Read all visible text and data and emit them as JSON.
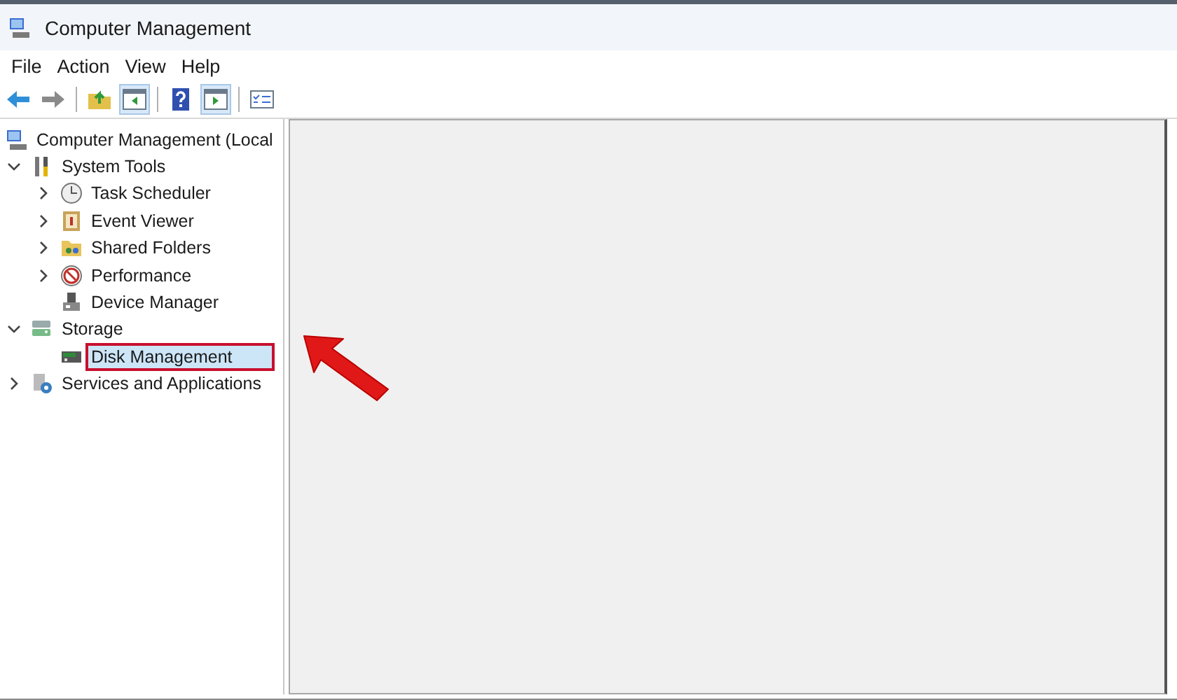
{
  "window": {
    "title": "Computer Management"
  },
  "menu": [
    "File",
    "Action",
    "View",
    "Help"
  ],
  "toolbar": [
    {
      "kind": "back",
      "pressed": false
    },
    {
      "kind": "forward",
      "pressed": false
    },
    {
      "kind": "sep"
    },
    {
      "kind": "up",
      "pressed": false
    },
    {
      "kind": "tree",
      "pressed": true
    },
    {
      "kind": "sep"
    },
    {
      "kind": "help",
      "pressed": false
    },
    {
      "kind": "pane",
      "pressed": true
    },
    {
      "kind": "sep"
    },
    {
      "kind": "props",
      "pressed": false
    }
  ],
  "tree": [
    {
      "label": "Computer Management (Local",
      "kind": "computer",
      "selected": false,
      "highlighted": false,
      "children": [
        {
          "label": "System Tools",
          "kind": "tools",
          "expanded": true,
          "selected": false,
          "highlighted": false,
          "children": [
            {
              "label": "Task Scheduler",
              "kind": "clock",
              "expanded": false,
              "selected": false,
              "highlighted": false
            },
            {
              "label": "Event Viewer",
              "kind": "event",
              "expanded": false,
              "selected": false,
              "highlighted": false
            },
            {
              "label": "Shared Folders",
              "kind": "folder",
              "expanded": false,
              "selected": false,
              "highlighted": false
            },
            {
              "label": "Performance",
              "kind": "performance",
              "expanded": false,
              "selected": false,
              "highlighted": false
            },
            {
              "label": "Device Manager",
              "kind": "device",
              "selected": false,
              "highlighted": false
            }
          ]
        },
        {
          "label": "Storage",
          "kind": "storage",
          "expanded": true,
          "selected": false,
          "highlighted": false,
          "children": [
            {
              "label": "Disk Management",
              "kind": "disk",
              "selected": true,
              "highlighted": true
            }
          ]
        },
        {
          "label": "Services and Applications",
          "kind": "services",
          "expanded": false,
          "selected": false,
          "highlighted": false
        }
      ]
    }
  ]
}
